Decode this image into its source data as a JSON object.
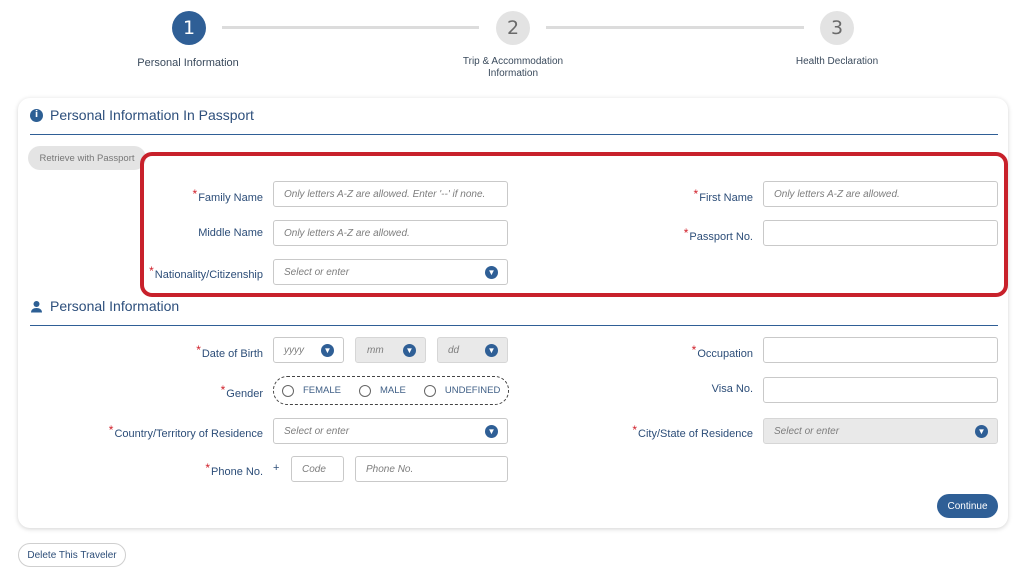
{
  "steps": [
    {
      "number": "1",
      "label": "Personal Information"
    },
    {
      "number": "2",
      "label_line1": "Trip & Accommodation",
      "label_line2": "Information"
    },
    {
      "number": "3",
      "label": "Health Declaration"
    }
  ],
  "passport_section": {
    "title": "Personal Information In Passport",
    "info_icon": "i",
    "retrieve_button": "Retrieve with Passport",
    "family_name": {
      "label": "Family Name",
      "placeholder": "Only letters A-Z are allowed. Enter '--' if none."
    },
    "first_name": {
      "label": "First Name",
      "placeholder": "Only letters A-Z are allowed."
    },
    "middle_name": {
      "label": "Middle Name",
      "placeholder": "Only letters A-Z are allowed."
    },
    "passport_no": {
      "label": "Passport No.",
      "placeholder": ""
    },
    "nationality": {
      "label": "Nationality/Citizenship",
      "placeholder": "Select or enter"
    }
  },
  "personal_section": {
    "title": "Personal Information",
    "dob": {
      "label": "Date of Birth",
      "year": "yyyy",
      "month": "mm",
      "day": "dd"
    },
    "occupation": {
      "label": "Occupation"
    },
    "gender": {
      "label": "Gender",
      "options": [
        "FEMALE",
        "MALE",
        "UNDEFINED"
      ]
    },
    "visa_no": {
      "label": "Visa No."
    },
    "country_residence": {
      "label": "Country/Territory of Residence",
      "placeholder": "Select or enter"
    },
    "city_residence": {
      "label": "City/State of Residence",
      "placeholder": "Select or enter"
    },
    "phone": {
      "label": "Phone No.",
      "plus": "+",
      "code_placeholder": "Code",
      "number_placeholder": "Phone No."
    }
  },
  "continue_button": "Continue",
  "delete_button": "Delete This Traveler",
  "required_mark": "*",
  "colors": {
    "primary": "#2f5f96",
    "required": "#d0202a",
    "highlight": "#c8212b"
  }
}
